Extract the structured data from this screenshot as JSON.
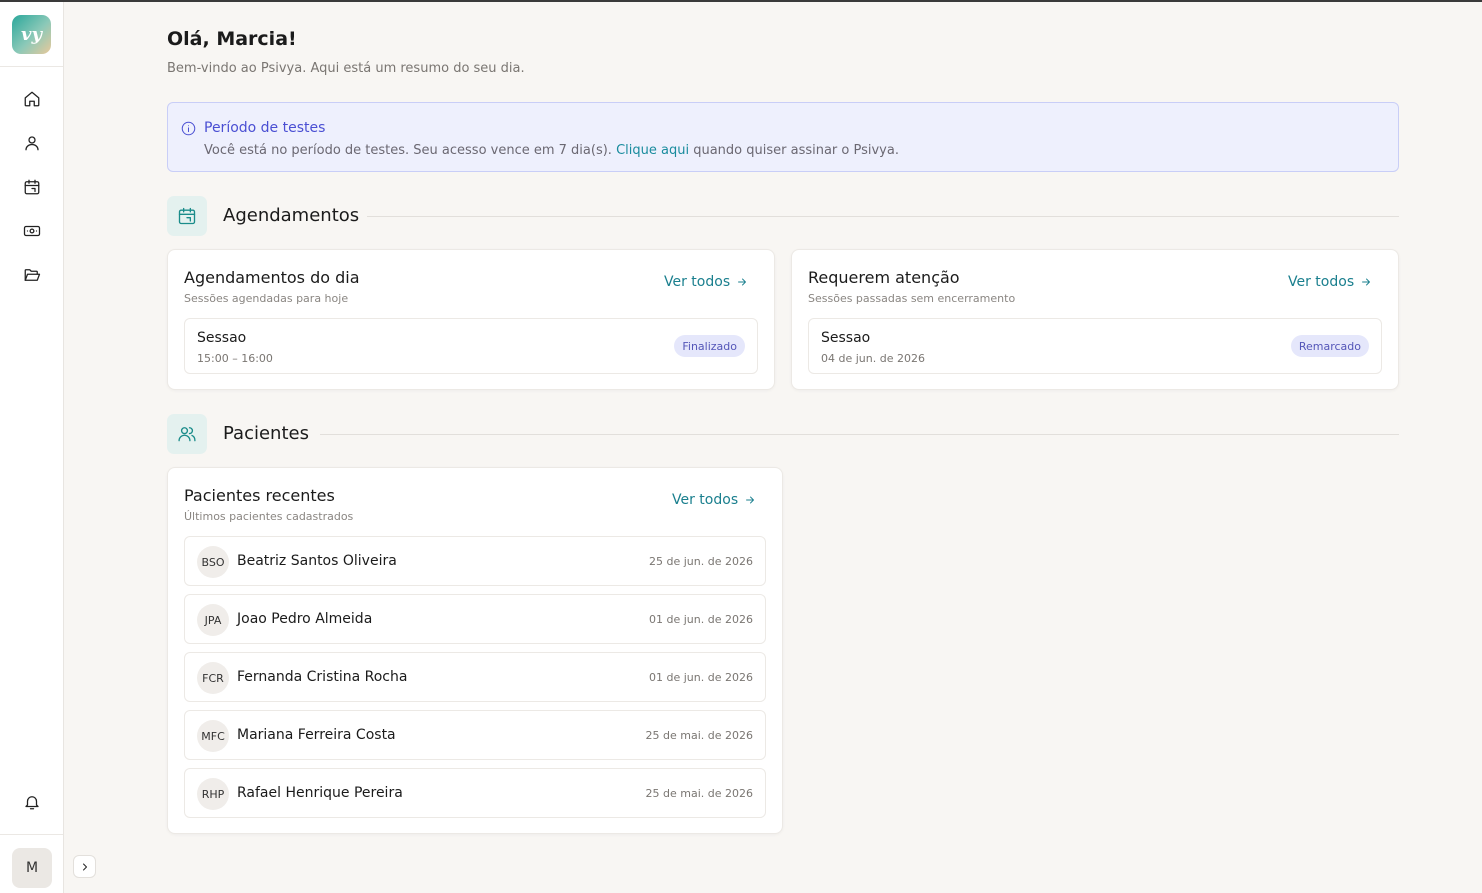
{
  "sidebar": {
    "logo_text": "vy",
    "nav": [
      {
        "name": "home",
        "icon": "home-icon"
      },
      {
        "name": "patients",
        "icon": "user-icon"
      },
      {
        "name": "calendar",
        "icon": "calendar-icon"
      },
      {
        "name": "finance",
        "icon": "money-icon"
      },
      {
        "name": "files",
        "icon": "folder-open-icon"
      }
    ],
    "notifications_icon": "bell-icon",
    "user_initial": "M",
    "expand_icon": "chevron-right-icon"
  },
  "header": {
    "greeting": "Olá, Marcia!",
    "subtitle": "Bem-vindo ao Psivya. Aqui está um resumo do seu dia."
  },
  "trial": {
    "title": "Período de testes",
    "text_before": "Você está no período de testes. Seu acesso vence em 7 dia(s). ",
    "link": "Clique aqui",
    "text_after": " quando quiser assinar o Psivya.",
    "accent": "#4a4fd3"
  },
  "appointments": {
    "section_title": "Agendamentos",
    "today": {
      "title": "Agendamentos do dia",
      "subtitle": "Sessões agendadas para hoje",
      "link": "Ver todos",
      "items": [
        {
          "name": "Sessao",
          "time": "15:00 – 16:00",
          "status": "Finalizado"
        }
      ]
    },
    "attention": {
      "title": "Requerem atenção",
      "subtitle": "Sessões passadas sem encerramento",
      "link": "Ver todos",
      "items": [
        {
          "name": "Sessao",
          "time": "04 de jun. de 2026",
          "status": "Remarcado"
        }
      ]
    }
  },
  "patients": {
    "section_title": "Pacientes",
    "recent": {
      "title": "Pacientes recentes",
      "subtitle": "Últimos pacientes cadastrados",
      "link": "Ver todos",
      "items": [
        {
          "initials": "BSO",
          "name": "Beatriz Santos Oliveira",
          "date": "25 de jun. de 2026"
        },
        {
          "initials": "JPA",
          "name": "Joao Pedro Almeida",
          "date": "01 de jun. de 2026"
        },
        {
          "initials": "FCR",
          "name": "Fernanda Cristina Rocha",
          "date": "01 de jun. de 2026"
        },
        {
          "initials": "MFC",
          "name": "Mariana Ferreira Costa",
          "date": "25 de mai. de 2026"
        },
        {
          "initials": "RHP",
          "name": "Rafael Henrique Pereira",
          "date": "25 de mai. de 2026"
        }
      ]
    }
  },
  "colors": {
    "teal": "#1a7f8e",
    "badge_bg": "#e5e7fb",
    "badge_text": "#5456b8",
    "background": "#f8f6f3"
  }
}
